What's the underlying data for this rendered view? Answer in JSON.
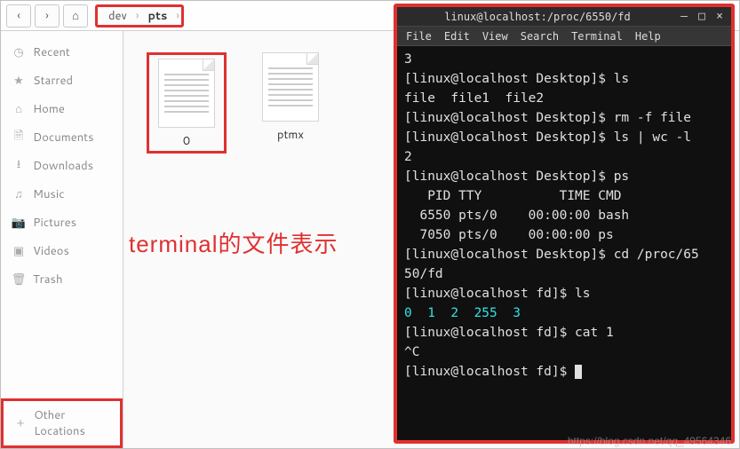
{
  "file_manager": {
    "path_segments": [
      "dev",
      "pts"
    ],
    "path_active_index": 1,
    "back_icon": "‹",
    "fwd_icon": "›",
    "home_icon": "⌂",
    "sidebar": [
      {
        "name": "recent",
        "glyph": "◷",
        "label": "Recent"
      },
      {
        "name": "starred",
        "glyph": "★",
        "label": "Starred"
      },
      {
        "name": "home",
        "glyph": "⌂",
        "label": "Home"
      },
      {
        "name": "documents",
        "glyph": "🗎",
        "label": "Documents"
      },
      {
        "name": "downloads",
        "glyph": "⭳",
        "label": "Downloads"
      },
      {
        "name": "music",
        "glyph": "♫",
        "label": "Music"
      },
      {
        "name": "pictures",
        "glyph": "📷",
        "label": "Pictures"
      },
      {
        "name": "videos",
        "glyph": "▣",
        "label": "Videos"
      },
      {
        "name": "trash",
        "glyph": "🗑",
        "label": "Trash"
      }
    ],
    "other_locations": {
      "glyph": "+",
      "label": "Other Locations"
    },
    "files": [
      {
        "name": "0"
      },
      {
        "name": "ptmx"
      }
    ]
  },
  "annotation": {
    "text": "terminal的文件表示"
  },
  "terminal": {
    "title": "linux@localhost:/proc/6550/fd",
    "win_buttons": {
      "min": "–",
      "max": "□",
      "close": "×"
    },
    "menu": [
      "File",
      "Edit",
      "View",
      "Search",
      "Terminal",
      "Help"
    ],
    "lines": {
      "l1": "3",
      "l2": "[linux@localhost Desktop]$ ls",
      "l3": "file  file1  file2",
      "l4": "[linux@localhost Desktop]$ rm -f file",
      "l5": "[linux@localhost Desktop]$ ls | wc -l",
      "l6": "2",
      "l7": "[linux@localhost Desktop]$ ps",
      "l8": "   PID TTY          TIME CMD",
      "l9": "  6550 pts/0    00:00:00 bash",
      "l10": "  7050 pts/0    00:00:00 ps",
      "l11": "[linux@localhost Desktop]$ cd /proc/65",
      "l12": "50/fd",
      "l13": "[linux@localhost fd]$ ls",
      "l14": "0  1  2  255  3",
      "l15": "[linux@localhost fd]$ cat 1",
      "l16": "^C",
      "l17": "[linux@localhost fd]$ "
    }
  },
  "watermark": "https://blog.csdn.net/qq_49564346"
}
